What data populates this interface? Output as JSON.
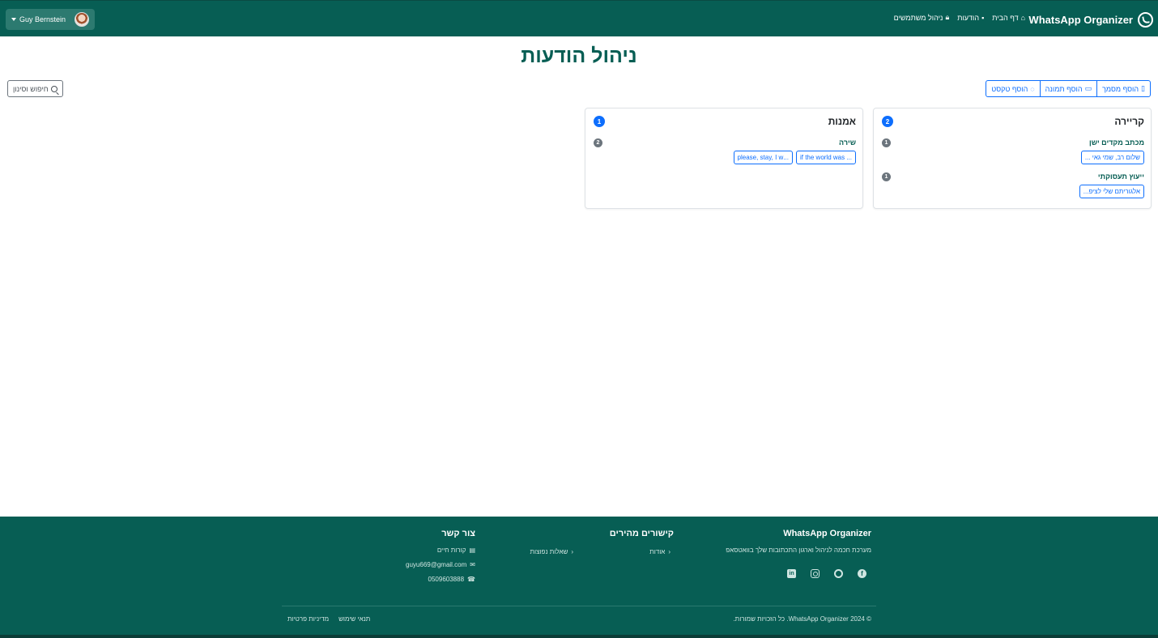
{
  "navbar": {
    "brand": "WhatsApp Organizer",
    "links": [
      {
        "label": "דף הבית",
        "icon": "home-icon"
      },
      {
        "label": "הודעות",
        "icon": "chat-bubble-icon"
      },
      {
        "label": "ניהול משתמשים",
        "icon": "lock-icon"
      }
    ],
    "user_name": "Guy Bernstein"
  },
  "page": {
    "title": "ניהול הודעות"
  },
  "toolbar": {
    "add_document": "הוסף מסמך",
    "add_image": "הוסף תמונה",
    "add_text": "הוסף טקסט",
    "search_filter": "חיפוש וסינון"
  },
  "categories": [
    {
      "title": "קריירה",
      "count": "2",
      "subcategories": [
        {
          "title": "מכתב מקדים ישן",
          "count": "1",
          "messages": [
            "שלום רב, שמי גאי ..."
          ]
        },
        {
          "title": "ייעוץ תעסוקתי",
          "count": "1",
          "messages": [
            "אלגוריתם שלי לציפ..."
          ]
        }
      ]
    },
    {
      "title": "אמנות",
      "count": "1",
      "subcategories": [
        {
          "title": "שירה",
          "count": "2",
          "messages": [
            "... if the world was",
            "...please, stay, I w"
          ]
        }
      ]
    }
  ],
  "footer": {
    "brand": "WhatsApp Organizer",
    "tagline": "מערכת חכמה לניהול וארגון התכתובות שלך בוואטסאפ",
    "quick_links_title": "קישורים מהירים",
    "quick_links": [
      "אודות",
      "שאלות נפוצות"
    ],
    "contact_title": "צור קשר",
    "contact": {
      "resume": "קורות חיים",
      "email": "guyu669@gmail.com",
      "phone": "0509603888"
    },
    "copyright": "© 2024 WhatsApp Organizer. כל הזכויות שמורות.",
    "terms": "תנאי שימוש",
    "privacy": "מדיניות פרטיות"
  },
  "colors": {
    "brand_green": "#075e54",
    "primary_blue": "#0d6efd",
    "badge_gray": "#6c757d"
  }
}
